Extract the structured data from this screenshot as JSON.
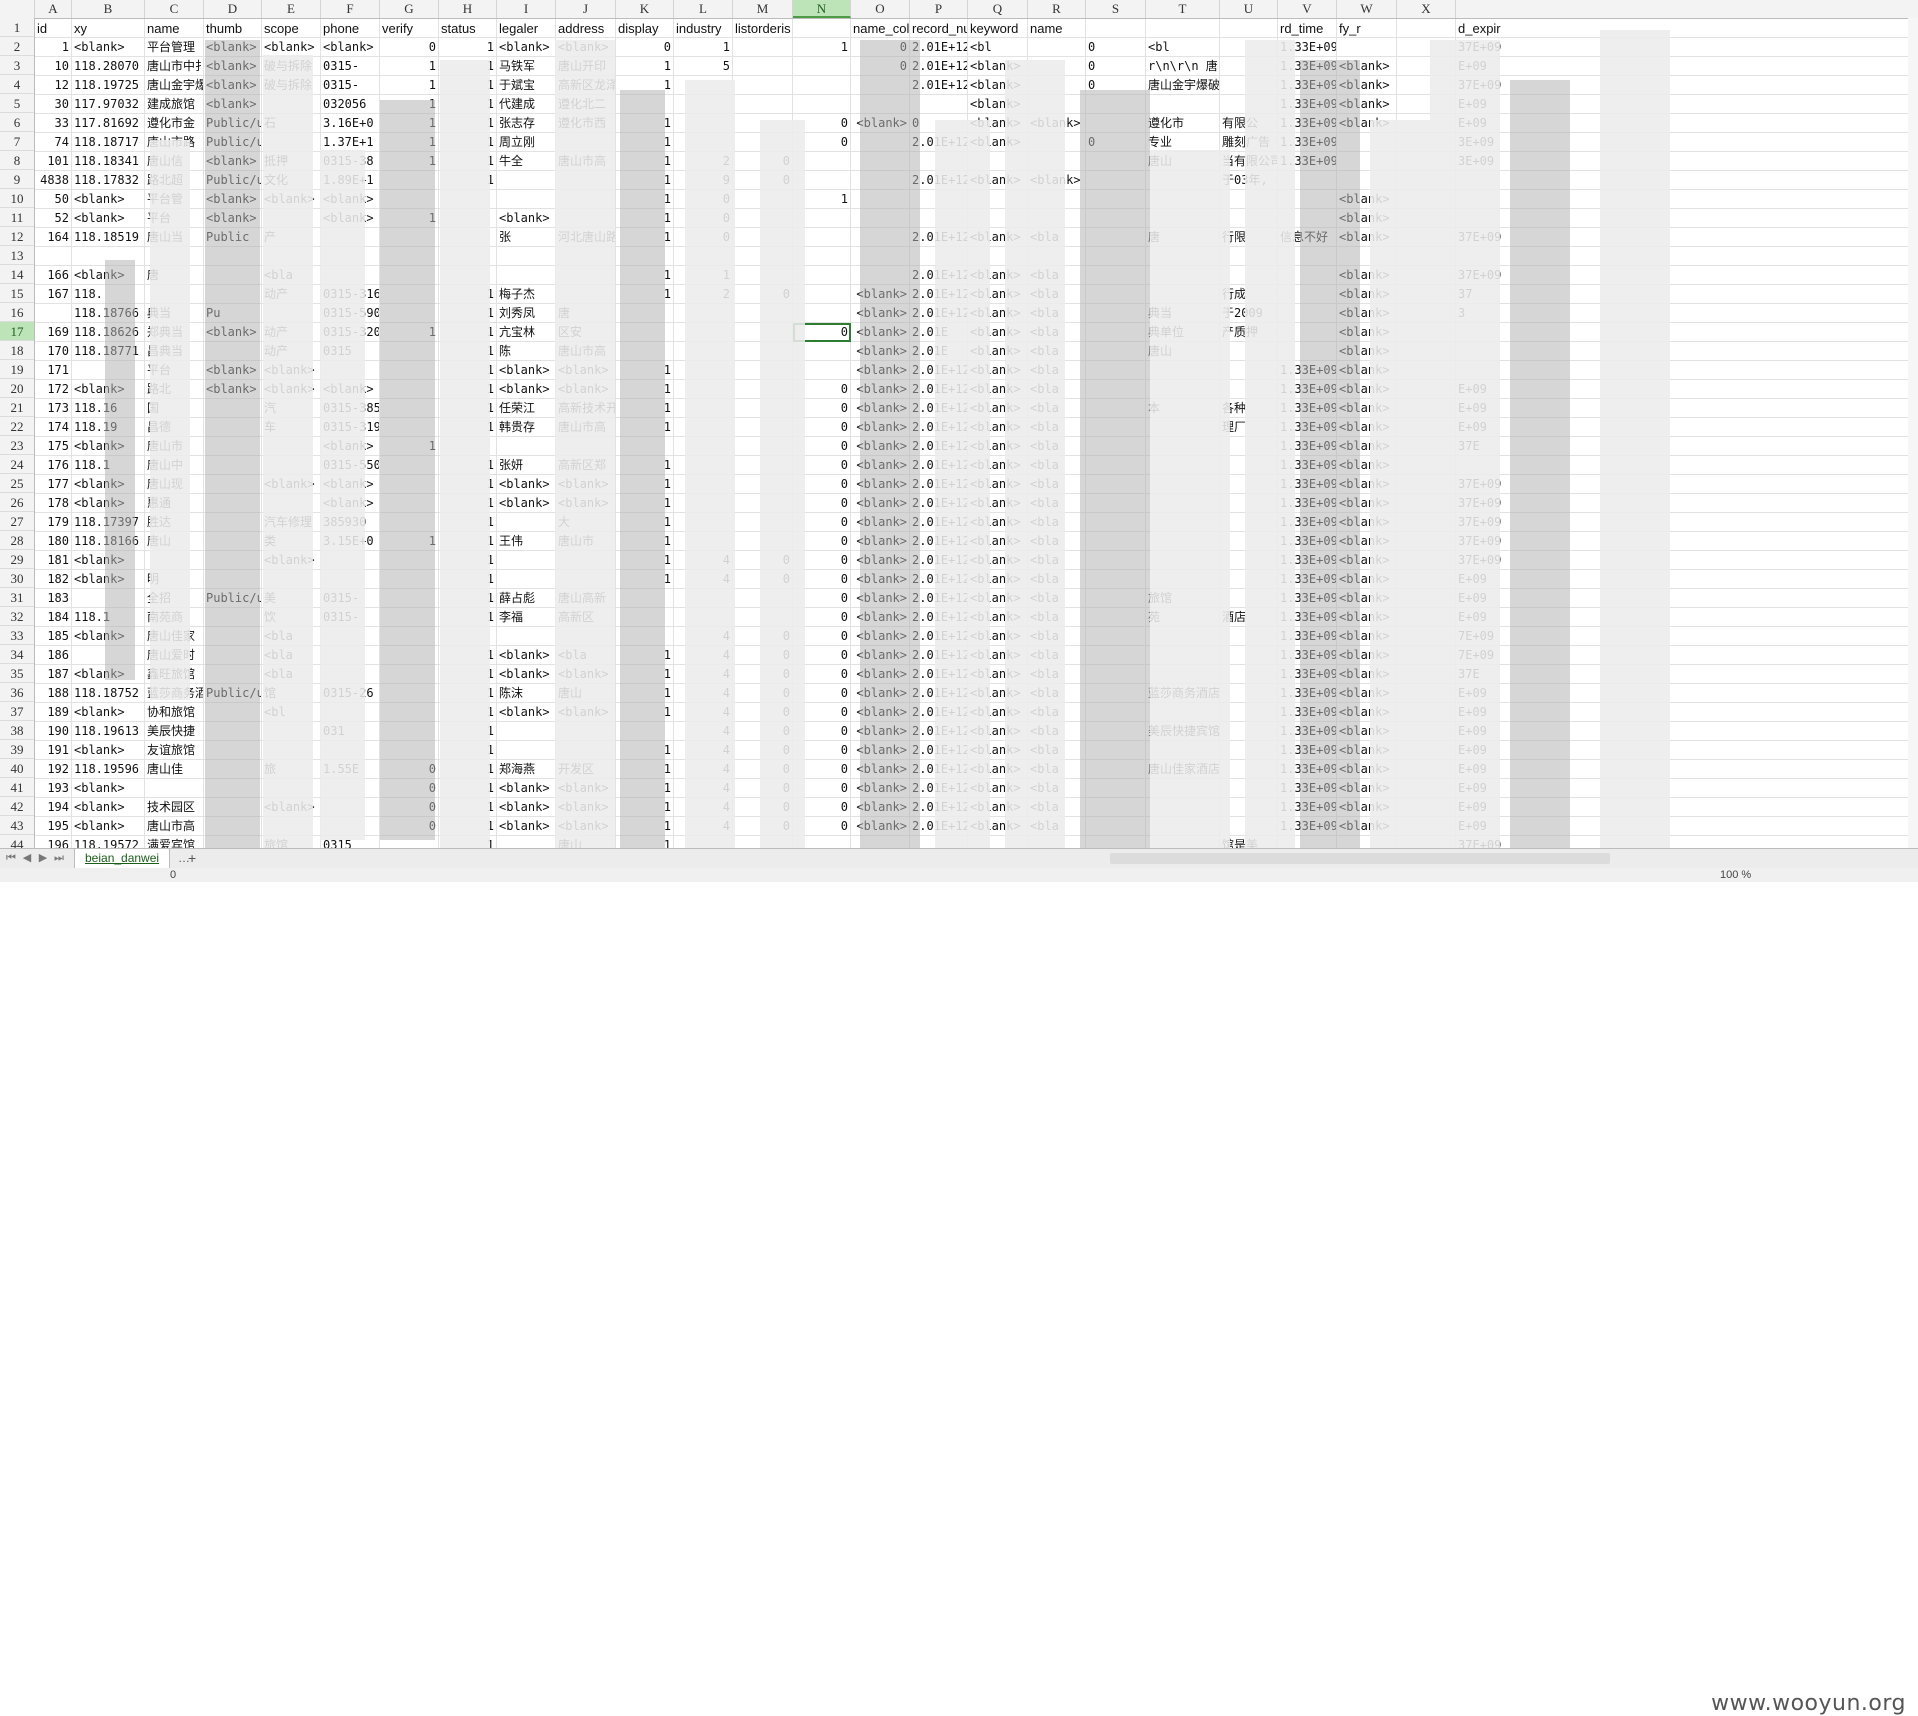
{
  "columns": [
    "A",
    "B",
    "C",
    "D",
    "E",
    "F",
    "G",
    "H",
    "I",
    "J",
    "K",
    "L",
    "M",
    "N",
    "O",
    "P",
    "Q",
    "R",
    "S",
    "T",
    "U",
    "V",
    "W",
    "X"
  ],
  "selected_column": "N",
  "selected_row": "17",
  "header_row": {
    "number": "1",
    "cells": [
      "id",
      "xy",
      "name",
      "thumb",
      "scope",
      "phone",
      "verify",
      "status",
      "legaler",
      "address",
      "display",
      "industry",
      "listorderis",
      "",
      "name_col",
      "record_nu",
      "keyword",
      "name",
      "",
      "",
      "",
      "rd_time",
      "fy_r",
      "",
      "d_expir"
    ]
  },
  "rows": [
    {
      "n": "2",
      "cells": [
        "1",
        "<blank>",
        "平台管理",
        "<blank>",
        "<blank>",
        "<blank>",
        "0",
        "1",
        "<blank>",
        "<blank>",
        "0",
        "1",
        "",
        "1",
        "0",
        "2.01E+12",
        "<bl",
        "",
        "0",
        "<bl",
        "",
        "1.33E+09",
        "",
        "",
        "37E+09"
      ]
    },
    {
      "n": "3",
      "cells": [
        "10",
        "118.28070",
        "唐山市中扌",
        "<blank>",
        "破与拆除",
        "0315-",
        "1",
        "1",
        "马铁军",
        "唐山开印",
        "1",
        "5",
        "",
        "",
        "0",
        "2.01E+12",
        "<blank>",
        "",
        "0",
        "r\\n\\r\\n   唐山",
        "",
        "1.33E+09",
        "<blank>",
        "",
        "E+09"
      ]
    },
    {
      "n": "4",
      "cells": [
        "12",
        "118.19725",
        "唐山金宇爆",
        "<blank>",
        "破与拆除",
        "0315-",
        "1",
        "1",
        "于斌宝",
        "高新区龙泽",
        "1",
        "",
        "",
        "",
        "",
        "2.01E+12",
        "<blank>",
        "",
        "0",
        "唐山金宇爆破工程有",
        "",
        "1.33E+09",
        "<blank>",
        "",
        "37E+09"
      ]
    },
    {
      "n": "5",
      "cells": [
        "30",
        "117.97032",
        "建成旅馆",
        "<blank>",
        "",
        "032056",
        "1",
        "1",
        "代建成",
        "遵化北二",
        "",
        "",
        "",
        "",
        "",
        "",
        "<blank>",
        "",
        "",
        "",
        "",
        "1.33E+09",
        "<blank>",
        "",
        "E+09"
      ]
    },
    {
      "n": "6",
      "cells": [
        "33",
        "117.81692",
        "遵化市金",
        "Public/up",
        "石",
        "3.16E+0",
        "1",
        "1",
        "张志存",
        "遵化市西",
        "1",
        "",
        "",
        "0",
        "<blank>",
        "0",
        "<blank>",
        "<blank>",
        "",
        "遵化市",
        "有限公",
        "1.33E+09",
        "<blank>",
        "",
        "E+09"
      ]
    },
    {
      "n": "7",
      "cells": [
        "74",
        "118.18717",
        "唐山市路",
        "Public/up",
        "",
        "1.37E+1",
        "1",
        "1",
        "周立刚",
        "",
        "1",
        "",
        "",
        "0",
        "",
        "2.01E+12",
        "<blank>",
        "",
        "0",
        "专业",
        "雕刻广告",
        "1.33E+09",
        "",
        "",
        "3E+09"
      ]
    },
    {
      "n": "8",
      "cells": [
        "101",
        "118.18341",
        "唐山信",
        "<blank>",
        "抵押",
        "0315-38",
        "1",
        "1",
        "牛全",
        "唐山市高",
        "1",
        "2",
        "0",
        "",
        "",
        "",
        "",
        "",
        "",
        "唐山",
        "当有限公司",
        "1.33E+09",
        "",
        "",
        "3E+09"
      ]
    },
    {
      "n": "9",
      "cells": [
        "4838",
        "118.17832",
        "路北超",
        "Public/u",
        "文化",
        "1.89E+1",
        "",
        "1",
        "",
        "",
        "1",
        "9",
        "0",
        "",
        "",
        "2.01E+12",
        "<blank>",
        "<blank>",
        "",
        "",
        "于03年,",
        "",
        "",
        "",
        ""
      ]
    },
    {
      "n": "10",
      "cells": [
        "50",
        "<blank>",
        "平台管",
        "<blank>",
        "<blank>",
        "<blank>",
        "",
        "",
        "",
        "",
        "1",
        "0",
        "",
        "1",
        "",
        "",
        "",
        "",
        "",
        "",
        "",
        "",
        "<blank>",
        "",
        ""
      ]
    },
    {
      "n": "11",
      "cells": [
        "52",
        "<blank>",
        "平台",
        "<blank>",
        "",
        "<blank>",
        "1",
        "",
        "<blank>",
        "",
        "1",
        "0",
        "",
        "",
        "",
        "",
        "",
        "",
        "",
        "",
        "",
        "",
        "<blank>",
        "",
        ""
      ]
    },
    {
      "n": "12",
      "cells": [
        "164",
        "118.18519",
        "唐山当",
        "Public",
        "产",
        "",
        "",
        "",
        "张",
        "河北唐山路",
        "1",
        "0",
        "",
        "",
        "",
        "2.01E+12",
        "<blank>",
        "<bla",
        "",
        "唐",
        "行限",
        "信息不好",
        "<blank>",
        "",
        "37E+09"
      ]
    },
    {
      "n": "13",
      "cells": [
        "",
        "",
        "",
        "",
        "",
        "",
        "",
        "",
        "",
        "",
        "",
        "",
        "",
        "",
        "",
        "",
        "",
        "",
        "",
        "",
        "",
        "",
        "",
        "",
        ""
      ]
    },
    {
      "n": "14",
      "cells": [
        "166",
        "<blank>",
        "唐",
        "",
        "<bla",
        "",
        "",
        "",
        "",
        "",
        "1",
        "1",
        "",
        "",
        "",
        "2.01E+12",
        "<blank>",
        "<bla",
        "",
        "",
        "",
        "",
        "<blank>",
        "",
        "37E+09"
      ]
    },
    {
      "n": "15",
      "cells": [
        "167",
        "118.",
        "",
        "",
        "动产",
        "0315-3160",
        "",
        "1",
        "梅子杰",
        "",
        "1",
        "2",
        "0",
        "",
        "<blank>",
        "2.01E+12",
        "<blank>",
        "<bla",
        "",
        "",
        "行成",
        "",
        "<blank>",
        "",
        "37"
      ]
    },
    {
      "n": "16",
      "cells": [
        "",
        "118.18766",
        "典当",
        "Pu",
        "",
        "0315-5900",
        "",
        "1",
        "刘秀凤",
        "唐",
        "",
        "",
        "",
        "",
        "<blank>",
        "2.01E+12",
        "<blank>",
        "<bla",
        "",
        "典当",
        "于2009",
        "",
        "<blank>",
        "",
        "3"
      ]
    },
    {
      "n": "17",
      "cells": [
        "169",
        "118.18626",
        "郑典当",
        "<blank>",
        "动产",
        "0315-3200",
        "1",
        "1",
        "亢宝林",
        "区安",
        "",
        "",
        "",
        "0",
        "<blank>",
        "2.01E",
        "<blank>",
        "<bla",
        "",
        "典单位",
        "产质押",
        "",
        "<blank>",
        "",
        ""
      ]
    },
    {
      "n": "18",
      "cells": [
        "170",
        "118.18771",
        "昌典当",
        "",
        "动产",
        "0315",
        "",
        "1",
        "陈",
        "唐山市高",
        "",
        "",
        "",
        "",
        "<blank>",
        "2.01E",
        "<blank>",
        "<bla",
        "",
        "唐山",
        "",
        "",
        "<blank>",
        "",
        ""
      ]
    },
    {
      "n": "19",
      "cells": [
        "171",
        "",
        "平台",
        "<blank>",
        "<blank>",
        "",
        "",
        "1",
        "<blank>",
        "<blank>",
        "1",
        "",
        "",
        "",
        "<blank>",
        "2.01E+12",
        "<blank>",
        "<bla",
        "",
        "",
        "",
        "1.33E+09",
        "<blank>",
        "",
        ""
      ]
    },
    {
      "n": "20",
      "cells": [
        "172",
        "<blank>",
        "路北",
        "<blank>",
        "<blank>",
        "<blank>",
        "",
        "1",
        "<blank>",
        "<blank>",
        "1",
        "",
        "",
        "0",
        "<blank>",
        "2.01E+12",
        "<blank>",
        "<bla",
        "",
        "",
        "",
        "1.33E+09",
        "<blank>",
        "",
        "E+09"
      ]
    },
    {
      "n": "21",
      "cells": [
        "173",
        "118.16",
        "国",
        "",
        "汽",
        "0315-3859",
        "",
        "1",
        "任荣江",
        "高新技术开",
        "1",
        "",
        "",
        "0",
        "<blank>",
        "2.01E+12",
        "<blank>",
        "<bla",
        "",
        "本",
        "各种",
        "1.33E+09",
        "<blank>",
        "",
        "E+09"
      ]
    },
    {
      "n": "22",
      "cells": [
        "174",
        "118.19",
        "昌德",
        "",
        "车",
        "0315-3190",
        "",
        "1",
        "韩贵存",
        "唐山市高",
        "1",
        "",
        "",
        "0",
        "<blank>",
        "2.01E+12",
        "<blank>",
        "<bla",
        "",
        "",
        "理厂",
        "1.33E+09",
        "<blank>",
        "",
        "E+09"
      ]
    },
    {
      "n": "23",
      "cells": [
        "175",
        "<blank>",
        "唐山市",
        "",
        "",
        "<blank>",
        "1",
        "",
        "",
        "",
        "",
        "",
        "",
        "0",
        "<blank>",
        "2.01E+12",
        "<blank>",
        "<bla",
        "",
        "",
        "",
        "1.33E+09",
        "<blank>",
        "",
        "37E"
      ]
    },
    {
      "n": "24",
      "cells": [
        "176",
        "118.1",
        "唐山中",
        "",
        "",
        "0315-5500",
        "",
        "1",
        "张妍",
        "高新区郑",
        "1",
        "",
        "",
        "0",
        "<blank>",
        "2.01E+12",
        "<blank>",
        "<bla",
        "",
        "",
        "",
        "1.33E+09",
        "<blank>",
        "",
        ""
      ]
    },
    {
      "n": "25",
      "cells": [
        "177",
        "<blank>",
        "唐山现",
        "",
        "<blank>",
        "<blank>",
        "",
        "1",
        "<blank>",
        "<blank>",
        "1",
        "",
        "",
        "0",
        "<blank>",
        "2.01E+12",
        "<blank>",
        "<bla",
        "",
        "",
        "",
        "1.33E+09",
        "<blank>",
        "",
        "37E+09"
      ]
    },
    {
      "n": "26",
      "cells": [
        "178",
        "<blank>",
        "惠通",
        "",
        "",
        "<blank>",
        "",
        "1",
        "<blank>",
        "<blank>",
        "1",
        "",
        "",
        "0",
        "<blank>",
        "2.01E+12",
        "<blank>",
        "<bla",
        "",
        "",
        "",
        "1.33E+09",
        "<blank>",
        "",
        "37E+09"
      ]
    },
    {
      "n": "27",
      "cells": [
        "179",
        "118.17397",
        "胜达",
        "",
        "汽车修理",
        "385930",
        "",
        "1",
        "",
        "大",
        "1",
        "",
        "",
        "0",
        "<blank>",
        "2.01E+12",
        "<blank>",
        "<bla",
        "",
        "",
        "",
        "1.33E+09",
        "<blank>",
        "",
        "37E+09"
      ]
    },
    {
      "n": "28",
      "cells": [
        "180",
        "118.18166",
        "唐山",
        "",
        "类",
        "3.15E+0",
        "1",
        "1",
        "王伟",
        "唐山市",
        "1",
        "",
        "",
        "0",
        "<blank>",
        "2.01E+12",
        "<blank>",
        "<bla",
        "",
        "",
        "",
        "1.33E+09",
        "<blank>",
        "",
        "37E+09"
      ]
    },
    {
      "n": "29",
      "cells": [
        "181",
        "<blank>",
        "",
        "",
        "<blank>",
        "",
        "",
        "1",
        "",
        "",
        "1",
        "4",
        "0",
        "0",
        "<blank>",
        "2.01E+12",
        "<blank>",
        "<bla",
        "",
        "",
        "",
        "1.33E+09",
        "<blank>",
        "",
        "37E+09"
      ]
    },
    {
      "n": "30",
      "cells": [
        "182",
        "<blank>",
        "明",
        "",
        "",
        "",
        "",
        "1",
        "",
        "",
        "1",
        "4",
        "0",
        "0",
        "<blank>",
        "2.01E+12",
        "<blank>",
        "<bla",
        "",
        "",
        "",
        "1.33E+09",
        "<blank>",
        "",
        "E+09"
      ]
    },
    {
      "n": "31",
      "cells": [
        "183",
        "",
        "全招",
        "Public/up",
        "美",
        "0315-",
        "",
        "1",
        "薛占彪",
        "唐山高新",
        "",
        "",
        "",
        "0",
        "<blank>",
        "2.01E+12",
        "<blank>",
        "<bla",
        "",
        "旅馆",
        "",
        "1.33E+09",
        "<blank>",
        "",
        "E+09"
      ]
    },
    {
      "n": "32",
      "cells": [
        "184",
        "118.1",
        "南苑商",
        "",
        "饮",
        "0315-",
        "",
        "1",
        "李福",
        "高新区",
        "",
        "",
        "",
        "0",
        "<blank>",
        "2.01E+12",
        "<blank>",
        "<bla",
        "",
        "苑",
        "酒店",
        "1.33E+09",
        "<blank>",
        "",
        "E+09"
      ]
    },
    {
      "n": "33",
      "cells": [
        "185",
        "<blank>",
        "唐山佳家",
        "",
        "<bla",
        "",
        "",
        "",
        "",
        "",
        "",
        "4",
        "0",
        "0",
        "<blank>",
        "2.01E+12",
        "<blank>",
        "<bla",
        "",
        "",
        "",
        "1.33E+09",
        "<blank>",
        "",
        "7E+09"
      ]
    },
    {
      "n": "34",
      "cells": [
        "186",
        "",
        "唐山爱时",
        "",
        "<bla",
        "",
        "",
        "1",
        "<blank>",
        "<bla",
        "1",
        "4",
        "0",
        "0",
        "<blank>",
        "2.01E+12",
        "<blank>",
        "<bla",
        "",
        "",
        "",
        "1.33E+09",
        "<blank>",
        "",
        "7E+09"
      ]
    },
    {
      "n": "35",
      "cells": [
        "187",
        "<blank>",
        "鑫旺旅馆",
        "",
        "<bla",
        "",
        "",
        "1",
        "<blank>",
        "<blank>",
        "1",
        "4",
        "0",
        "0",
        "<blank>",
        "2.01E+12",
        "<blank>",
        "<bla",
        "",
        "",
        "",
        "1.33E+09",
        "<blank>",
        "",
        "37E"
      ]
    },
    {
      "n": "36",
      "cells": [
        "188",
        "118.18752",
        "蓝莎商务酒",
        "Public/up",
        "馆",
        "0315-26",
        "",
        "1",
        "陈沫",
        "唐山",
        "1",
        "4",
        "0",
        "0",
        "<blank>",
        "2.01E+12",
        "<blank>",
        "<bla",
        "",
        "蓝莎商务酒店是瑞沙集",
        "",
        "1.33E+09",
        "<blank>",
        "",
        "E+09"
      ]
    },
    {
      "n": "37",
      "cells": [
        "189",
        "<blank>",
        "协和旅馆",
        "",
        "<bl",
        "",
        "",
        "1",
        "<blank>",
        "<blank>",
        "1",
        "4",
        "0",
        "0",
        "<blank>",
        "2.01E+12",
        "<blank>",
        "<bla",
        "",
        "",
        "",
        "1.33E+09",
        "<blank>",
        "",
        "E+09"
      ]
    },
    {
      "n": "38",
      "cells": [
        "190",
        "118.19613",
        "美辰快捷",
        "",
        "",
        "031",
        "",
        "1",
        "",
        "",
        "",
        "4",
        "0",
        "0",
        "<blank>",
        "2.01E+12",
        "<blank>",
        "<bla",
        "",
        "美辰快捷宾馆位于",
        "",
        "1.33E+09",
        "<blank>",
        "",
        "E+09"
      ]
    },
    {
      "n": "39",
      "cells": [
        "191",
        "<blank>",
        "友谊旅馆",
        "",
        "",
        "",
        "",
        "1",
        "",
        "",
        "1",
        "4",
        "0",
        "0",
        "<blank>",
        "2.01E+12",
        "<blank>",
        "<bla",
        "",
        "",
        "",
        "1.33E+09",
        "<blank>",
        "",
        "E+09"
      ]
    },
    {
      "n": "40",
      "cells": [
        "192",
        "118.19596",
        "唐山佳",
        "",
        "旅",
        "1.55E",
        "0",
        "1",
        "郑海燕",
        "开发区",
        "1",
        "4",
        "0",
        "0",
        "<blank>",
        "2.01E+12",
        "<blank>",
        "<bla",
        "",
        "唐山佳家酒店",
        "",
        "1.33E+09",
        "<blank>",
        "",
        "E+09"
      ]
    },
    {
      "n": "41",
      "cells": [
        "193",
        "<blank>",
        "",
        "",
        "",
        "",
        "0",
        "1",
        "<blank>",
        "<blank>",
        "1",
        "4",
        "0",
        "0",
        "<blank>",
        "2.01E+12",
        "<blank>",
        "<bla",
        "",
        "",
        "",
        "1.33E+09",
        "<blank>",
        "",
        "E+09"
      ]
    },
    {
      "n": "42",
      "cells": [
        "194",
        "<blank>",
        "技术园区",
        "",
        "<blank>",
        "",
        "0",
        "1",
        "<blank>",
        "<blank>",
        "1",
        "4",
        "0",
        "0",
        "<blank>",
        "2.01E+12",
        "<blank>",
        "<bla",
        "",
        "",
        "",
        "1.33E+09",
        "<blank>",
        "",
        "E+09"
      ]
    },
    {
      "n": "43",
      "cells": [
        "195",
        "<blank>",
        "唐山市高",
        "",
        "",
        "",
        "0",
        "1",
        "<blank>",
        "<blank>",
        "1",
        "4",
        "0",
        "0",
        "<blank>",
        "2.01E+12",
        "<blank>",
        "<bla",
        "",
        "",
        "",
        "1.33E+09",
        "<blank>",
        "",
        "E+09"
      ]
    },
    {
      "n": "44",
      "cells": [
        "196",
        "118.19572",
        "满爱宾馆",
        "",
        "旅馆",
        "0315",
        "",
        "1",
        "",
        "唐山",
        "1",
        "",
        "",
        "",
        "",
        "",
        "",
        "",
        "",
        "",
        "馆是美",
        "",
        "",
        "",
        "37E+09"
      ]
    }
  ],
  "tabs": {
    "sheet_name": "beian_danwei",
    "ellipsis": "…",
    "add": "+"
  },
  "status": {
    "left": "0",
    "zoom": "100 %"
  },
  "watermark": "www.wooyun.org",
  "colors": {
    "header_bg": "#f3f3f3",
    "selected_header_bg": "#bde3b9",
    "active_border": "#2e7d32"
  }
}
